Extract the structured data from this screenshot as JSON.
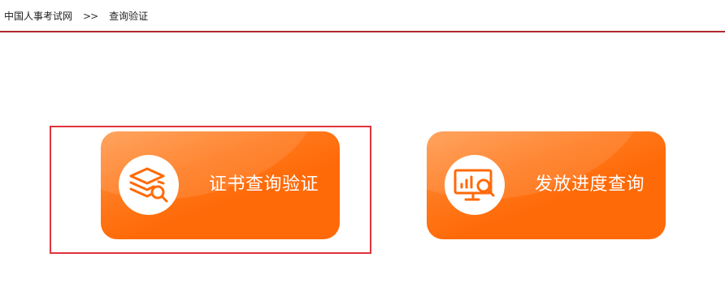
{
  "breadcrumb": {
    "home_label": "中国人事考试网",
    "separator": ">>",
    "current_label": "查询验证"
  },
  "tiles": [
    {
      "label": "证书查询验证",
      "icon": "layers-search-icon"
    },
    {
      "label": "发放进度查询",
      "icon": "monitor-chart-search-icon"
    }
  ],
  "colors": {
    "accent_orange": "#ff6a08",
    "divider_red": "#b0272d",
    "highlight_red": "#e0333c"
  }
}
